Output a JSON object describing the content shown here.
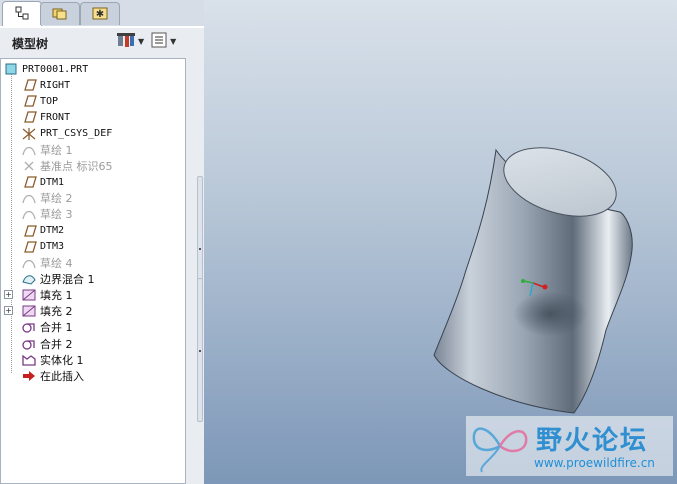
{
  "panel": {
    "title": "模型树"
  },
  "tabs": [
    {
      "icon": "model-tree-tab-icon",
      "active": true
    },
    {
      "icon": "folder-browser-tab-icon",
      "active": false
    },
    {
      "icon": "favorites-tab-icon",
      "active": false
    }
  ],
  "tree": {
    "items": [
      {
        "label": "PRT0001.PRT",
        "icon": "part-icon",
        "dim": false,
        "expandable": false
      },
      {
        "label": "RIGHT",
        "icon": "datum-plane-icon",
        "dim": false,
        "expandable": false
      },
      {
        "label": "TOP",
        "icon": "datum-plane-icon",
        "dim": false,
        "expandable": false
      },
      {
        "label": "FRONT",
        "icon": "datum-plane-icon",
        "dim": false,
        "expandable": false
      },
      {
        "label": "PRT_CSYS_DEF",
        "icon": "coordinate-system-icon",
        "dim": false,
        "expandable": false
      },
      {
        "label": "草绘 1",
        "icon": "sketch-icon",
        "dim": true,
        "expandable": false
      },
      {
        "label": "基准点 标识65",
        "icon": "datum-point-icon",
        "dim": true,
        "expandable": false
      },
      {
        "label": "DTM1",
        "icon": "datum-plane-icon",
        "dim": false,
        "expandable": false
      },
      {
        "label": "草绘 2",
        "icon": "sketch-icon",
        "dim": true,
        "expandable": false
      },
      {
        "label": "草绘 3",
        "icon": "sketch-icon",
        "dim": true,
        "expandable": false
      },
      {
        "label": "DTM2",
        "icon": "datum-plane-icon",
        "dim": false,
        "expandable": false
      },
      {
        "label": "DTM3",
        "icon": "datum-plane-icon",
        "dim": false,
        "expandable": false
      },
      {
        "label": "草绘 4",
        "icon": "sketch-icon",
        "dim": true,
        "expandable": false
      },
      {
        "label": "边界混合 1",
        "icon": "boundary-blend-icon",
        "dim": false,
        "expandable": false
      },
      {
        "label": "填充 1",
        "icon": "fill-icon",
        "dim": false,
        "expandable": true
      },
      {
        "label": "填充 2",
        "icon": "fill-icon",
        "dim": false,
        "expandable": true
      },
      {
        "label": "合并 1",
        "icon": "merge-icon",
        "dim": false,
        "expandable": false
      },
      {
        "label": "合并 2",
        "icon": "merge-icon",
        "dim": false,
        "expandable": false
      },
      {
        "label": "实体化 1",
        "icon": "solidify-icon",
        "dim": false,
        "expandable": false
      },
      {
        "label": "在此插入",
        "icon": "insert-here-arrow-icon",
        "dim": false,
        "expandable": false
      }
    ]
  },
  "toolbar": {
    "settings_icon": "tree-settings-icon",
    "columns_icon": "tree-columns-icon"
  },
  "watermark": {
    "title": "野火论坛",
    "url": "www.proewildfire.cn"
  },
  "colors": {
    "accent": "#2f8fd0",
    "plane": "#8a5a2b",
    "viewport_top": "#d9e1ea",
    "viewport_bottom": "#7d97b8"
  }
}
